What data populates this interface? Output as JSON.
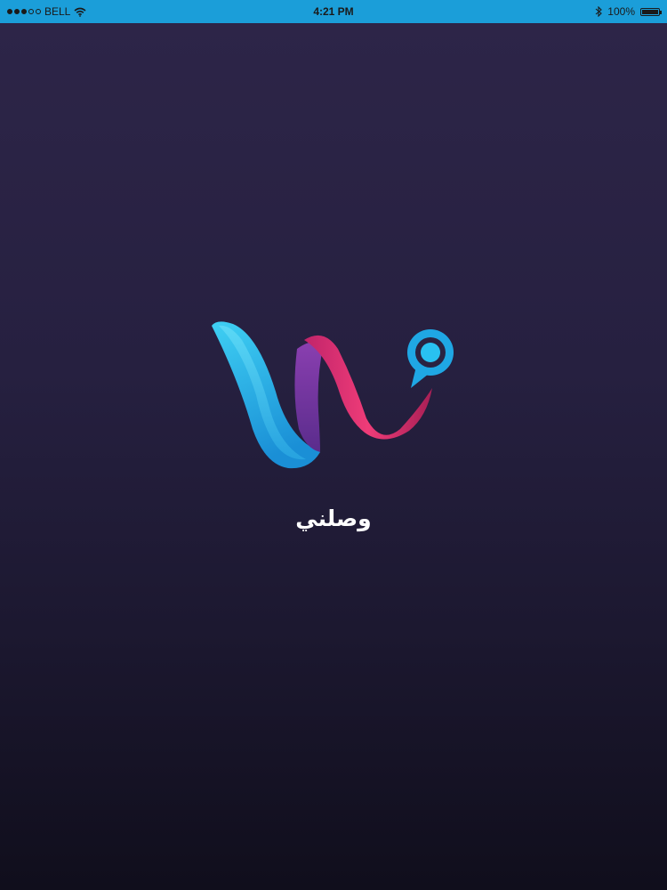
{
  "status_bar": {
    "carrier": "BELL",
    "time": "4:21 PM",
    "battery_text": "100%",
    "battery_level": 1.0,
    "signal_bars_filled": 3,
    "signal_bars_total": 5,
    "icons": [
      "wifi-icon",
      "bluetooth-icon",
      "battery-icon"
    ]
  },
  "splash": {
    "app_name": "وصلني",
    "logo": "wasalni-logo"
  },
  "colors": {
    "status_bar_bg": "#1b9ed9",
    "background_top": "#2d2548",
    "background_bottom": "#100e1c",
    "logo_blue": "#1ec0ef",
    "logo_purple": "#7a3aa8",
    "logo_pink": "#e8336f",
    "text": "#ffffff"
  }
}
